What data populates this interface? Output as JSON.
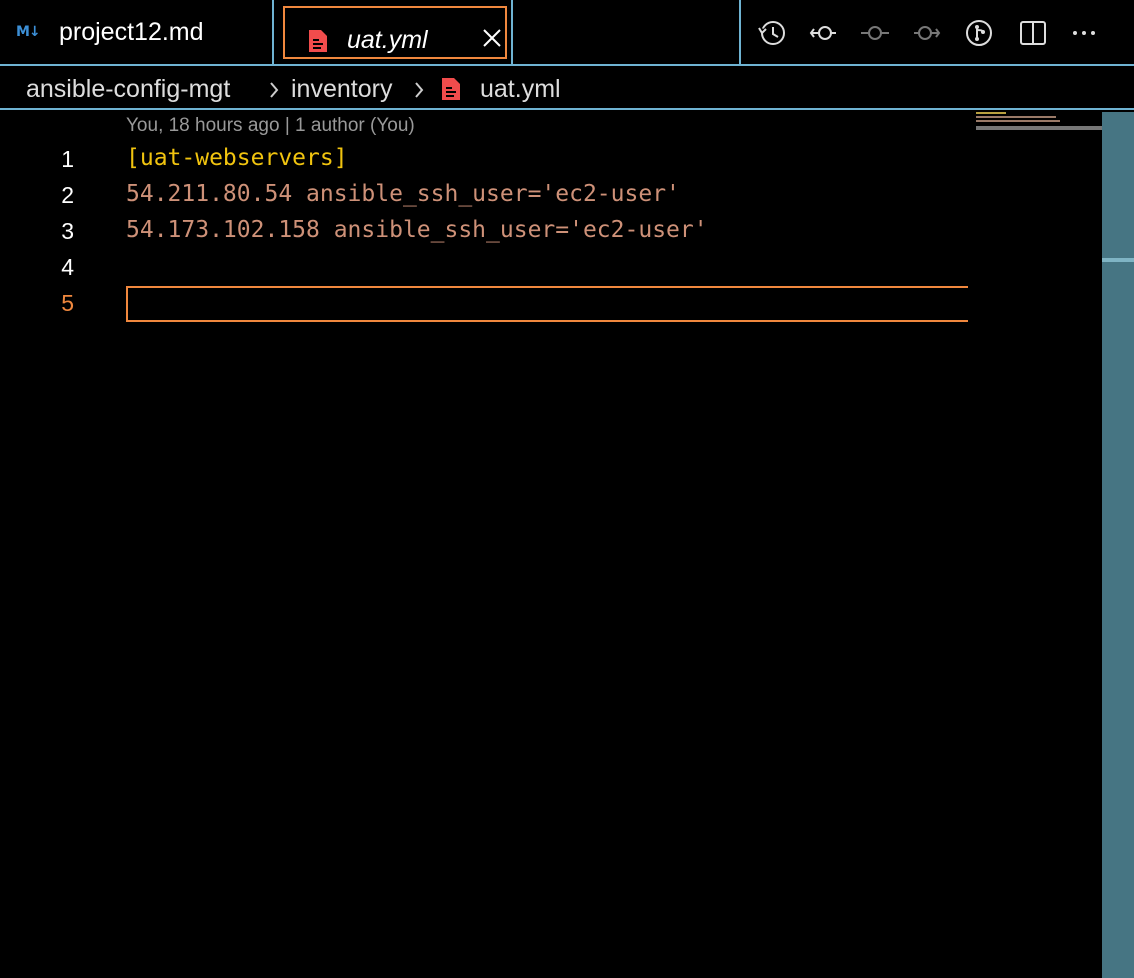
{
  "tabs": [
    {
      "label": "project12.md",
      "icon": "markdown-icon",
      "active": false
    },
    {
      "label": "uat.yml",
      "icon": "yaml-file-icon",
      "active": true
    }
  ],
  "breadcrumb": {
    "items": [
      "ansible-config-mgt",
      "inventory",
      "uat.yml"
    ]
  },
  "editor": {
    "blame": "You, 18 hours ago | 1 author (You)",
    "lines": [
      {
        "number": "1",
        "text": "[uat-webservers]"
      },
      {
        "number": "2",
        "text": "54.211.80.54 ansible_ssh_user='ec2-user'"
      },
      {
        "number": "3",
        "text": "54.173.102.158 ansible_ssh_user='ec2-user'"
      },
      {
        "number": "4",
        "text": ""
      },
      {
        "number": "5",
        "text": ""
      }
    ],
    "active_line": 5
  },
  "actions": [
    "history-icon",
    "previous-change-icon",
    "commit-icon",
    "next-change-icon",
    "source-control-graph-icon",
    "split-editor-icon",
    "more-actions-icon"
  ],
  "colors": {
    "accent_border": "#6fb3d2",
    "active_outline": "#f0883e",
    "string": "#ce9178",
    "section": "#f1c40f",
    "scrollbar": "#467583"
  }
}
